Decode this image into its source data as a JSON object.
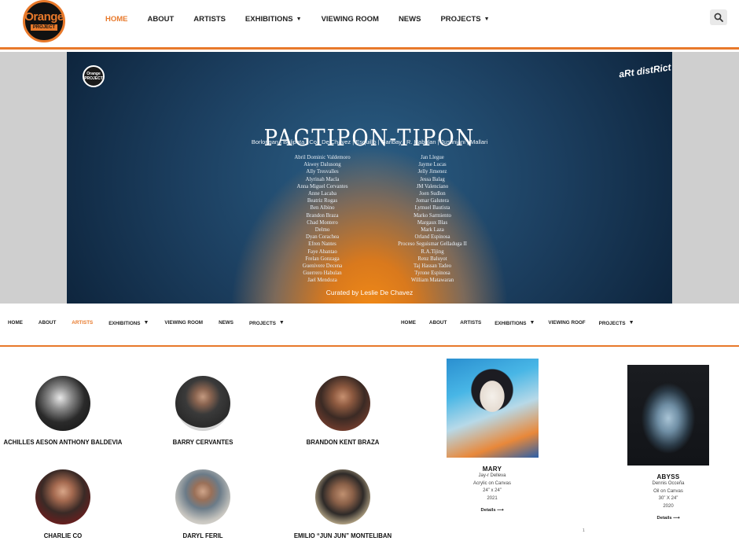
{
  "header": {
    "logo_top": "Orange",
    "logo_bottom": "PROJECT",
    "nav": [
      {
        "label": "HOME",
        "active": true,
        "dropdown": false
      },
      {
        "label": "ABOUT",
        "active": false,
        "dropdown": false
      },
      {
        "label": "ARTISTS",
        "active": false,
        "dropdown": false
      },
      {
        "label": "EXHIBITIONS",
        "active": false,
        "dropdown": true
      },
      {
        "label": "VIEWING ROOM",
        "active": false,
        "dropdown": false
      },
      {
        "label": "NEWS",
        "active": false,
        "dropdown": false
      },
      {
        "label": "PROJECTS",
        "active": false,
        "dropdown": true
      }
    ],
    "search_icon": "search-icon"
  },
  "hero": {
    "logo_top": "Orange",
    "logo_bottom": "PROJECT",
    "brand": "aRt distRict",
    "title": "PAGTIPON-TIPON",
    "featured_artists": "Borlongan | Bolipata | Co | De Chavez | Esquillo | Garibay | R. Habulan | Justiniani | Mallari",
    "left_names": [
      "Abril Dominic Valdemoro",
      "Akwey Dalusong",
      "Ally Tresvalles",
      "Alyrinah Macla",
      "Anna Miguel Cervantes",
      "Anne Lacaba",
      "Beatriz Rogas",
      "Ben Albino",
      "Brandon Braza",
      "Chad Montero",
      "Delmo",
      "Dyan Corachea",
      "Efren Nantes",
      "Faye Abantao",
      "Frelan Gonzaga",
      "Guenivere Decena",
      "Guerrero Habulan",
      "Jael Mendoza"
    ],
    "right_names": [
      "Jan Llegue",
      "Jayme Lucas",
      "Jelly Jimenez",
      "Jessa Balag",
      "JM Valenciano",
      "Joen Sudlon",
      "Jomar Galutera",
      "Lymuel Bautista",
      "Marko Sarmiento",
      "Margaux Blas",
      "Mark Laza",
      "Orland Espinosa",
      "Proceso Seguismar Gelladuga II",
      "R.A.Tijing",
      "Renz Baluyot",
      "Taj Hassan Tadeo",
      "Tyrone Espinosa",
      "William Matawaran"
    ],
    "curated_by": "Curated by Leslie De Chavez"
  },
  "sub_nav_left": [
    {
      "label": "HOME",
      "active": false,
      "dropdown": false
    },
    {
      "label": "ABOUT",
      "active": false,
      "dropdown": false
    },
    {
      "label": "ARTISTS",
      "active": true,
      "dropdown": false
    },
    {
      "label": "EXHIBITIONS",
      "active": false,
      "dropdown": true
    },
    {
      "label": "VIEWING ROOM",
      "active": false,
      "dropdown": false
    },
    {
      "label": "NEWS",
      "active": false,
      "dropdown": false
    },
    {
      "label": "PROJECTS",
      "active": false,
      "dropdown": true
    }
  ],
  "sub_nav_right": [
    {
      "label": "HOME",
      "active": false,
      "dropdown": false
    },
    {
      "label": "ABOUT",
      "active": false,
      "dropdown": false
    },
    {
      "label": "ARTISTS",
      "active": false,
      "dropdown": false
    },
    {
      "label": "EXHIBITIONS",
      "active": false,
      "dropdown": true
    },
    {
      "label": "VIEWING ROOF",
      "active": false,
      "dropdown": false
    },
    {
      "label": "PROJECTS",
      "active": false,
      "dropdown": true
    }
  ],
  "artists": [
    {
      "name": "ACHILLES AESON ANTHONY BALDEVIA"
    },
    {
      "name": "BARRY CERVANTES"
    },
    {
      "name": "BRANDON KENT BRAZA"
    },
    {
      "name": "CHARLIE CO"
    },
    {
      "name": "DARYL FERIL"
    },
    {
      "name": "EMILIO “JUN JUN” MONTELIBAN"
    }
  ],
  "artworks": [
    {
      "title": "MARY",
      "artist": "Jay-r Delleva",
      "medium": "Acrylic on Canvas",
      "size": "24” x 24”",
      "year": "2021",
      "details": "Details ⟶"
    },
    {
      "title": "ABYSS",
      "artist": "Dennis Occeña",
      "medium": "Oil on Canvas",
      "size": "30” X 24”",
      "year": "2020",
      "details": "Details ⟶"
    }
  ],
  "pager": "1",
  "colors": {
    "accent": "#e8792b",
    "poster_dark": "#0f2740",
    "poster_glow": "#f28a16"
  }
}
